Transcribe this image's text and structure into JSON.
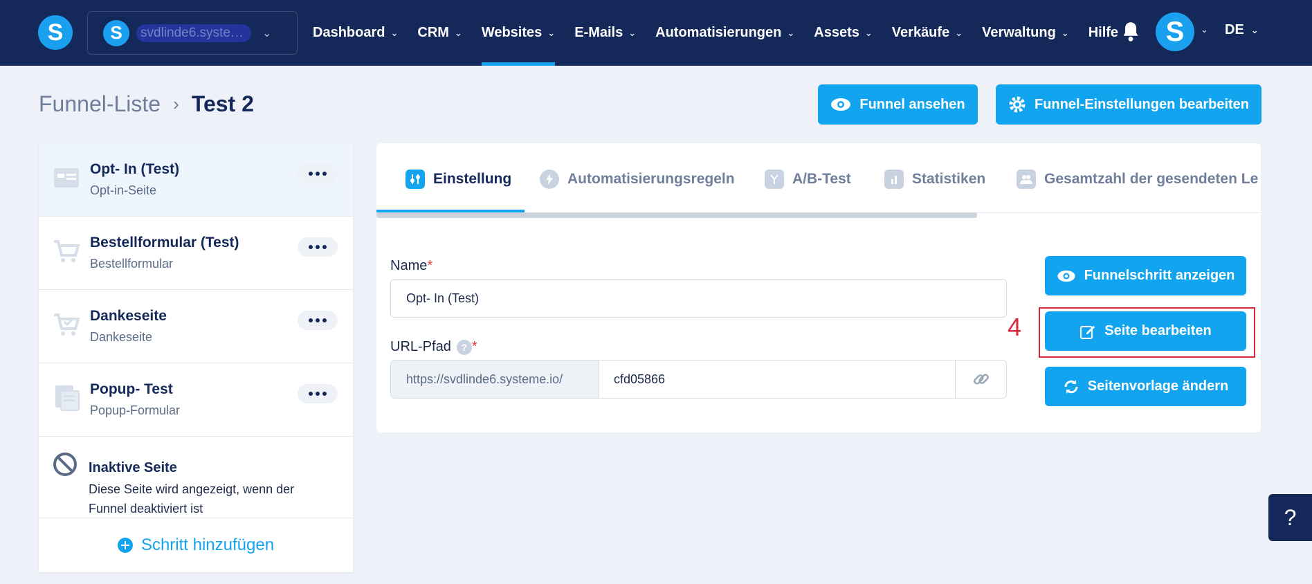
{
  "workspace": {
    "name": "svdlinde6.system..."
  },
  "nav": {
    "items": [
      {
        "label": "Dashboard",
        "chevron": true
      },
      {
        "label": "CRM",
        "chevron": true
      },
      {
        "label": "Websites",
        "chevron": true,
        "active": true
      },
      {
        "label": "E-Mails",
        "chevron": true
      },
      {
        "label": "Automatisierungen",
        "chevron": true
      },
      {
        "label": "Assets",
        "chevron": true
      },
      {
        "label": "Verkäufe",
        "chevron": true
      },
      {
        "label": "Verwaltung",
        "chevron": true
      },
      {
        "label": "Hilfe",
        "chevron": false
      }
    ],
    "language": "DE"
  },
  "breadcrumb": {
    "parent": "Funnel-Liste",
    "current": "Test 2"
  },
  "header_buttons": {
    "view": "Funnel ansehen",
    "settings": "Funnel-Einstellungen bearbeiten"
  },
  "steps": [
    {
      "title": "Opt- In (Test)",
      "subtitle": "Opt-in-Seite",
      "icon": "optin-page-icon"
    },
    {
      "title": "Bestellformular (Test)",
      "subtitle": "Bestellformular",
      "icon": "cart-icon"
    },
    {
      "title": "Dankeseite",
      "subtitle": "Dankeseite",
      "icon": "cart-check-icon"
    },
    {
      "title": "Popup- Test",
      "subtitle": "Popup-Formular",
      "icon": "popup-page-icon"
    }
  ],
  "inactive": {
    "title": "Inaktive Seite",
    "description": "Diese Seite wird angezeigt, wenn der Funnel deaktiviert ist"
  },
  "add_step": "Schritt hinzufügen",
  "tabs": [
    {
      "label": "Einstellung",
      "icon": "sliders-icon",
      "active": true
    },
    {
      "label": "Automatisierungsregeln",
      "icon": "bolt-icon"
    },
    {
      "label": "A/B-Test",
      "icon": "split-icon"
    },
    {
      "label": "Statistiken",
      "icon": "bar-chart-icon"
    },
    {
      "label": "Gesamtzahl der gesendeten Le",
      "icon": "users-icon"
    }
  ],
  "form": {
    "name_label": "Name",
    "name_value": "Opt- In (Test)",
    "url_label": "URL-Pfad",
    "url_prefix": "https://svdlinde6.systeme.io/",
    "url_value": "cfd05866",
    "required_mark": "*"
  },
  "actions": {
    "show_step": "Funnelschritt anzeigen",
    "edit_page": "Seite bearbeiten",
    "change_template": "Seitenvorlage ändern"
  },
  "annotation": "4",
  "help_fab": "?",
  "colors": {
    "navy": "#14295a",
    "accent": "#13a4f0",
    "highlight": "#d8273a"
  }
}
